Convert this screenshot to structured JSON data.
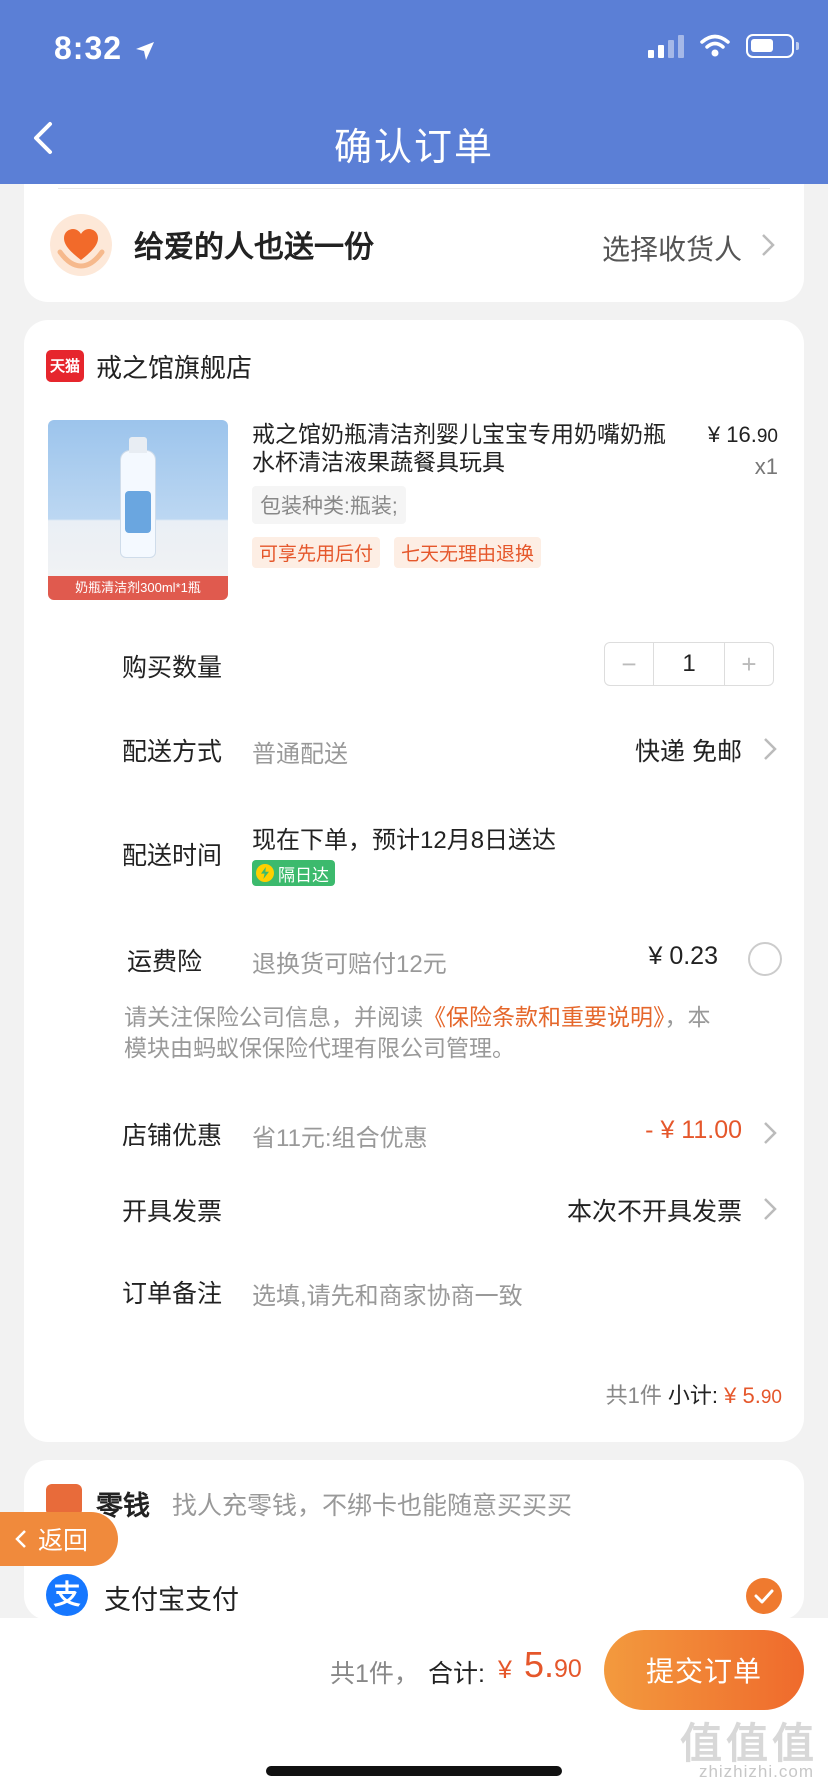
{
  "status_bar": {
    "time": "8:32"
  },
  "header": {
    "title": "确认订单"
  },
  "gift": {
    "text": "给爱的人也送一份",
    "action": "选择收货人"
  },
  "shop": {
    "logo_text": "天猫",
    "name": "戒之馆旗舰店"
  },
  "product": {
    "title": "戒之馆奶瓶清洁剂婴儿宝宝专用奶嘴奶瓶水杯清洁液果蔬餐具玩具",
    "price_int": "¥ 16.",
    "price_dec": "90",
    "quantity": "x1",
    "image_caption": "奶瓶清洁剂300ml*1瓶",
    "spec": "包装种类:瓶装;",
    "tags": [
      "可享先用后付",
      "七天无理由退换"
    ]
  },
  "rows": {
    "quantity": {
      "label": "购买数量",
      "minus": "−",
      "value": "1",
      "plus": "+"
    },
    "shipping": {
      "label": "配送方式",
      "value": "普通配送",
      "right": "快递 免邮"
    },
    "delivery": {
      "label": "配送时间",
      "value": "现在下单，预计12月8日送达",
      "badge": "隔日达"
    },
    "insurance": {
      "label": "运费险",
      "value": "退换货可赔付12元",
      "price": "¥ 0.23"
    },
    "notice": {
      "prefix": "请关注保险公司信息，并阅读",
      "link": "《保险条款和重要说明》",
      "suffix": "，本模块由蚂蚁保保险代理有限公司管理。"
    },
    "discount": {
      "label": "店铺优惠",
      "value": "省11元:组合优惠",
      "amount": "- ¥ 11.00"
    },
    "invoice": {
      "label": "开具发票",
      "right": "本次不开具发票"
    },
    "remark": {
      "label": "订单备注",
      "placeholder": "选填,请先和商家协商一致"
    }
  },
  "subtotal": {
    "count": "共1件",
    "label": "小计:",
    "amount_int": "¥ 5.",
    "amount_dec": "90"
  },
  "payment": {
    "wallet_label": "零钱",
    "wallet_desc": "找人充零钱，不绑卡也能随意买买买",
    "alipay_icon": "支",
    "alipay_label": "支付宝支付"
  },
  "float_back": {
    "label": "返回"
  },
  "bottom": {
    "count": "共1件，",
    "label": "合计:",
    "currency": "¥",
    "amount_int": "5.",
    "amount_dec": "90",
    "submit": "提交订单"
  },
  "watermark": {
    "main": "值值值",
    "sub": "zhizhizhi.com"
  },
  "colors": {
    "header_bg": "#5b7fd6",
    "accent": "#ef6a2c",
    "price_red": "#e5572b",
    "alipay_blue": "#1677ff",
    "next_day_green": "#3cba6d"
  }
}
